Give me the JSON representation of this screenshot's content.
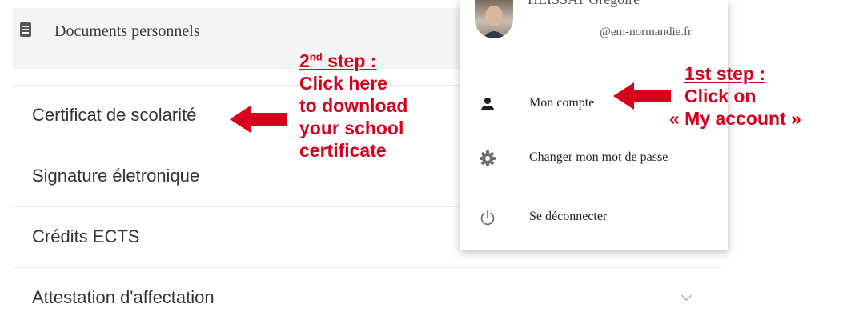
{
  "header": {
    "title": "Documents personnels",
    "icon": "document-icon"
  },
  "menu": [
    {
      "label": "Certificat de scolarité"
    },
    {
      "label": "Signature életronique"
    },
    {
      "label": "Crédits ECTS"
    },
    {
      "label": "Attestation d'affectation",
      "icon": "chevron-down-icon"
    }
  ],
  "account": {
    "name": "HEISSAT Grégoire",
    "email": "@em-normandie.fr",
    "items": [
      {
        "label": "Mon compte",
        "icon": "person-icon"
      },
      {
        "label": "Changer mon mot de passe",
        "icon": "gear-icon"
      },
      {
        "label": "Se déconnecter",
        "icon": "power-icon"
      }
    ]
  },
  "annotations": {
    "step1": {
      "title": "1st step :",
      "line1": "Click on",
      "line2": "« My account »"
    },
    "step2": {
      "title_num": "2",
      "title_sup": "nd",
      "title_rest": " step :",
      "line1": "Click here",
      "line2": "to download",
      "line3": "your school",
      "line4": "certificate"
    }
  },
  "colors": {
    "annotation": "#d6001c",
    "header_bg": "#f4f4f4",
    "text": "#333333"
  }
}
